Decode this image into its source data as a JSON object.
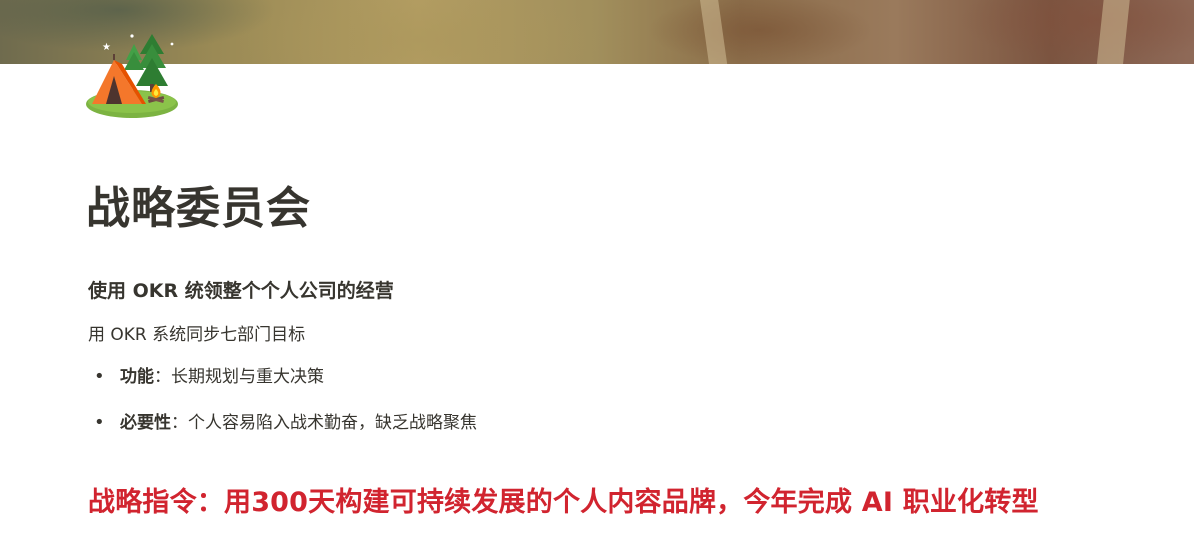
{
  "icon": {
    "name": "camping-tent-icon",
    "colors": {
      "tent": "#f4772b",
      "trees": "#2e7d32",
      "ground": "#7cb342",
      "fire": "#ff9800"
    }
  },
  "title": "战略委员会",
  "subtitle": "使用 OKR 统领整个个人公司的经营",
  "description": "用 OKR 系统同步七部门目标",
  "bullets": [
    {
      "label": "功能",
      "separator": "：",
      "text": "长期规划与重大决策"
    },
    {
      "label": "必要性",
      "separator": "：",
      "text": "个人容易陷入战术勤奋，缺乏战略聚焦"
    }
  ],
  "directive": "战略指令：用300天构建可持续发展的个人内容品牌，今年完成 AI 职业化转型",
  "colors": {
    "directive": "#d1242f",
    "text": "#37352f"
  }
}
